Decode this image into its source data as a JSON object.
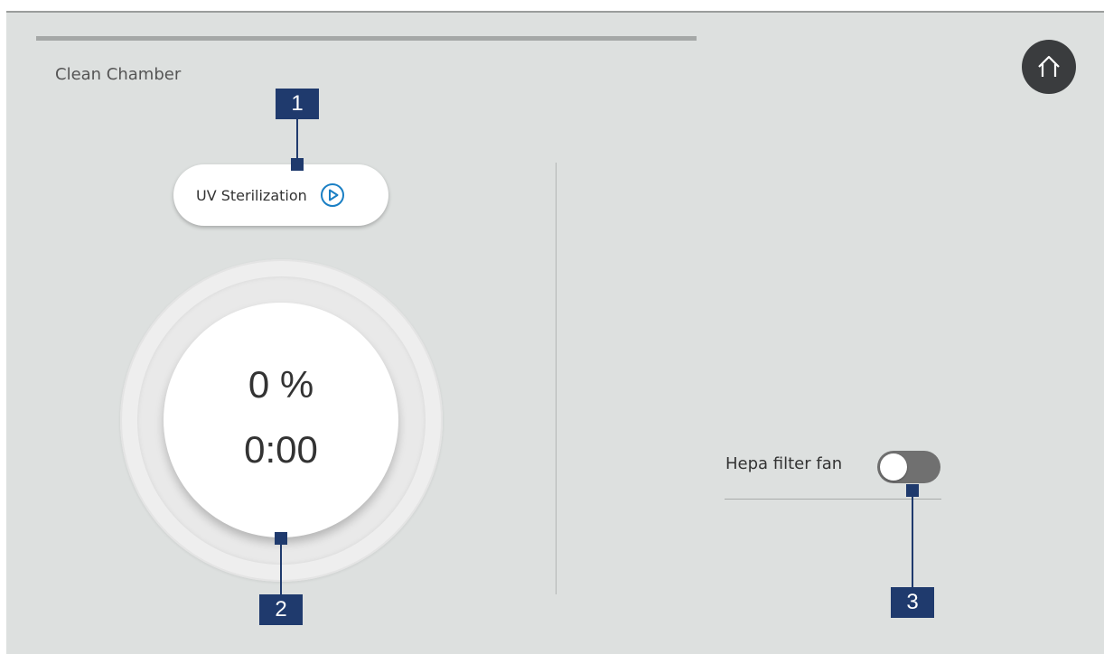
{
  "app": {
    "title": "Clean Chamber",
    "home_icon": "home-icon"
  },
  "uv": {
    "label": "UV Sterilization",
    "icon": "play-circle-icon",
    "accent": "#1a7fc4"
  },
  "progress": {
    "percent_text": "0 %",
    "time_text": "0:00",
    "percent_value": 0
  },
  "hepa": {
    "label": "Hepa filter fan",
    "enabled": false
  },
  "callouts": [
    {
      "number": "1"
    },
    {
      "number": "2"
    },
    {
      "number": "3"
    }
  ],
  "colors": {
    "callout": "#1f3a6d",
    "background": "#dde0df",
    "home_button": "#3a3c3e"
  }
}
